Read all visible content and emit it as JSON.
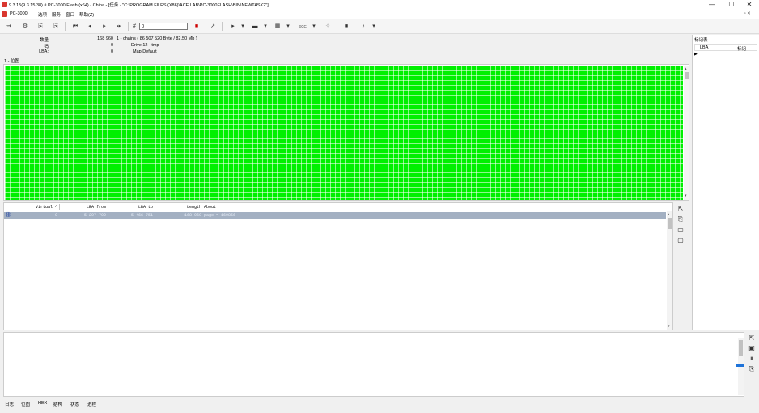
{
  "window": {
    "title": "9.3.15(9.3.15.38) # PC-3000 Flash (x64) - China - [任务 - \"C:\\PROGRAM FILES (X86)\\ACE LAB\\PC-3000FLASH\\BIN\\NEWTASK2\"]",
    "minimize": "—",
    "maximize": "☐",
    "close": "✕",
    "mdi_controls": "_ ▫ ✕"
  },
  "menu": {
    "items": [
      "PC-3000",
      "选项",
      "服务",
      "窗口",
      "帮助(Z)"
    ]
  },
  "toolbar": {
    "counter_value": "0",
    "ecc_label": "ECC",
    "dropdown_arrow": "▾"
  },
  "info": {
    "labels": [
      "数量",
      "码",
      "LBA:"
    ],
    "values": [
      "168 960",
      "0",
      "0"
    ],
    "details": [
      "1 - chains  ( 86 507 520 Byte / 82.50 Mb )",
      "Drive   12 - tmp",
      "Map    Default"
    ]
  },
  "map": {
    "label": "1 - 位图",
    "fill_color": "#00f000"
  },
  "chains": {
    "columns": [
      "Virtual ^",
      "LBA from",
      "LBA to",
      "Length",
      "About"
    ],
    "rows": [
      {
        "virtual": "0",
        "lba_from": "5 297 792",
        "lba_to": "5 466 751",
        "length": "168 960",
        "about": "page = 169856"
      }
    ]
  },
  "markers": {
    "title": "标记表",
    "columns": [
      "LBA",
      "标记"
    ]
  },
  "tabs": [
    "日志",
    "位图",
    "HEX",
    "结构",
    "状态",
    "进程"
  ],
  "colors": {
    "accent": "#d9362f",
    "selected_row": "#a3b0c2",
    "map_good": "#00f000",
    "progress": "#1e73d9"
  }
}
